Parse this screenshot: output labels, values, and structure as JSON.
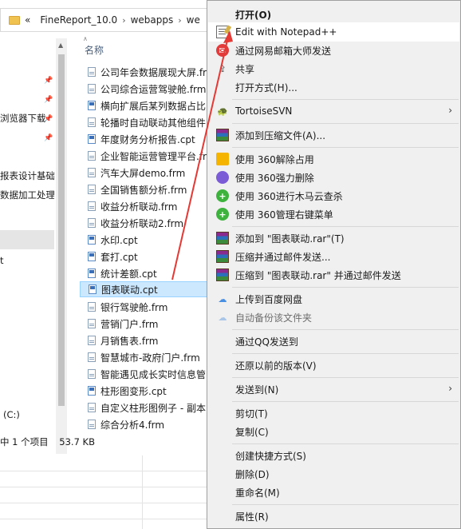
{
  "explorer": {
    "breadcrumb": [
      "«",
      "FineReport_10.0",
      "›",
      "webapps",
      "›",
      "we"
    ],
    "column_header": "名称",
    "nav_items": [
      {
        "label": "浏览器下载"
      },
      {
        "label": "报表设计基础"
      },
      {
        "label": "数据加工处理"
      },
      {
        "label": "t"
      }
    ],
    "drive_label": "(C:)",
    "files": [
      {
        "name": "公司年会数据展现大屏.frm",
        "type": "frm"
      },
      {
        "name": "公司综合运营驾驶舱.frm",
        "type": "frm"
      },
      {
        "name": "横向扩展后某列数据占比",
        "type": "cpt"
      },
      {
        "name": "轮播时自动联动其他组件",
        "type": "frm"
      },
      {
        "name": "年度财务分析报告.cpt",
        "type": "cpt"
      },
      {
        "name": "企业智能运营管理平台.fr",
        "type": "frm"
      },
      {
        "name": "汽车大屏demo.frm",
        "type": "frm"
      },
      {
        "name": "全国销售额分析.frm",
        "type": "frm"
      },
      {
        "name": "收益分析联动.frm",
        "type": "frm"
      },
      {
        "name": "收益分析联动2.frm",
        "type": "frm"
      },
      {
        "name": "水印.cpt",
        "type": "cpt"
      },
      {
        "name": "套打.cpt",
        "type": "cpt"
      },
      {
        "name": "统计差额.cpt",
        "type": "cpt"
      },
      {
        "name": "图表联动.cpt",
        "type": "cpt",
        "selected": true
      },
      {
        "name": "银行驾驶舱.frm",
        "type": "frm"
      },
      {
        "name": "营销门户.frm",
        "type": "frm"
      },
      {
        "name": "月销售表.frm",
        "type": "frm"
      },
      {
        "name": "智慧城市-政府门户.frm",
        "type": "frm"
      },
      {
        "name": "智能遇见成长实时信息管",
        "type": "frm"
      },
      {
        "name": "柱形图变形.cpt",
        "type": "cpt"
      },
      {
        "name": "自定义柱形图例子 - 副本",
        "type": "frm"
      },
      {
        "name": "综合分析4.frm",
        "type": "frm"
      }
    ],
    "status": {
      "selected": "中 1 个项目",
      "size": "53.7 KB"
    }
  },
  "context_menu": {
    "items": [
      {
        "label": "打开(O)",
        "icon": "none",
        "bold": true
      },
      {
        "label": "Edit with Notepad++",
        "icon": "notepad-plus-plus-icon",
        "hover": true
      },
      {
        "label": "通过网易邮箱大师发送",
        "icon": "netease-mail-icon"
      },
      {
        "label": "共享",
        "icon": "share-icon"
      },
      {
        "label": "打开方式(H)...",
        "icon": "none"
      },
      {
        "label": "TortoiseSVN",
        "icon": "tortoise-svn-icon",
        "submenu": true
      },
      {
        "label": "添加到压缩文件(A)...",
        "icon": "winrar-icon"
      },
      {
        "label": "使用 360解除占用",
        "icon": "360-unlock-icon"
      },
      {
        "label": "使用 360强力删除",
        "icon": "360-delete-icon"
      },
      {
        "label": "使用 360进行木马云查杀",
        "icon": "360-scan-icon"
      },
      {
        "label": "使用 360管理右键菜单",
        "icon": "360-manage-icon"
      },
      {
        "label": "添加到 \"图表联动.rar\"(T)",
        "icon": "winrar-icon"
      },
      {
        "label": "压缩并通过邮件发送...",
        "icon": "winrar-icon"
      },
      {
        "label": "压缩到 \"图表联动.rar\" 并通过邮件发送",
        "icon": "winrar-icon"
      },
      {
        "label": "上传到百度网盘",
        "icon": "baidu-netdisk-icon"
      },
      {
        "label": "自动备份该文件夹",
        "icon": "baidu-netdisk-icon",
        "disabled": true
      },
      {
        "label": "通过QQ发送到",
        "icon": "none"
      },
      {
        "label": "还原以前的版本(V)",
        "icon": "none"
      },
      {
        "label": "发送到(N)",
        "icon": "none",
        "submenu": true
      },
      {
        "label": "剪切(T)",
        "icon": "none"
      },
      {
        "label": "复制(C)",
        "icon": "none"
      },
      {
        "label": "创建快捷方式(S)",
        "icon": "none"
      },
      {
        "label": "删除(D)",
        "icon": "none"
      },
      {
        "label": "重命名(M)",
        "icon": "none"
      },
      {
        "label": "属性(R)",
        "icon": "none"
      }
    ]
  },
  "colors": {
    "annotation_arrow": "#e53935",
    "selection": "#cce8ff",
    "menu_bg": "#f0f0f0"
  }
}
